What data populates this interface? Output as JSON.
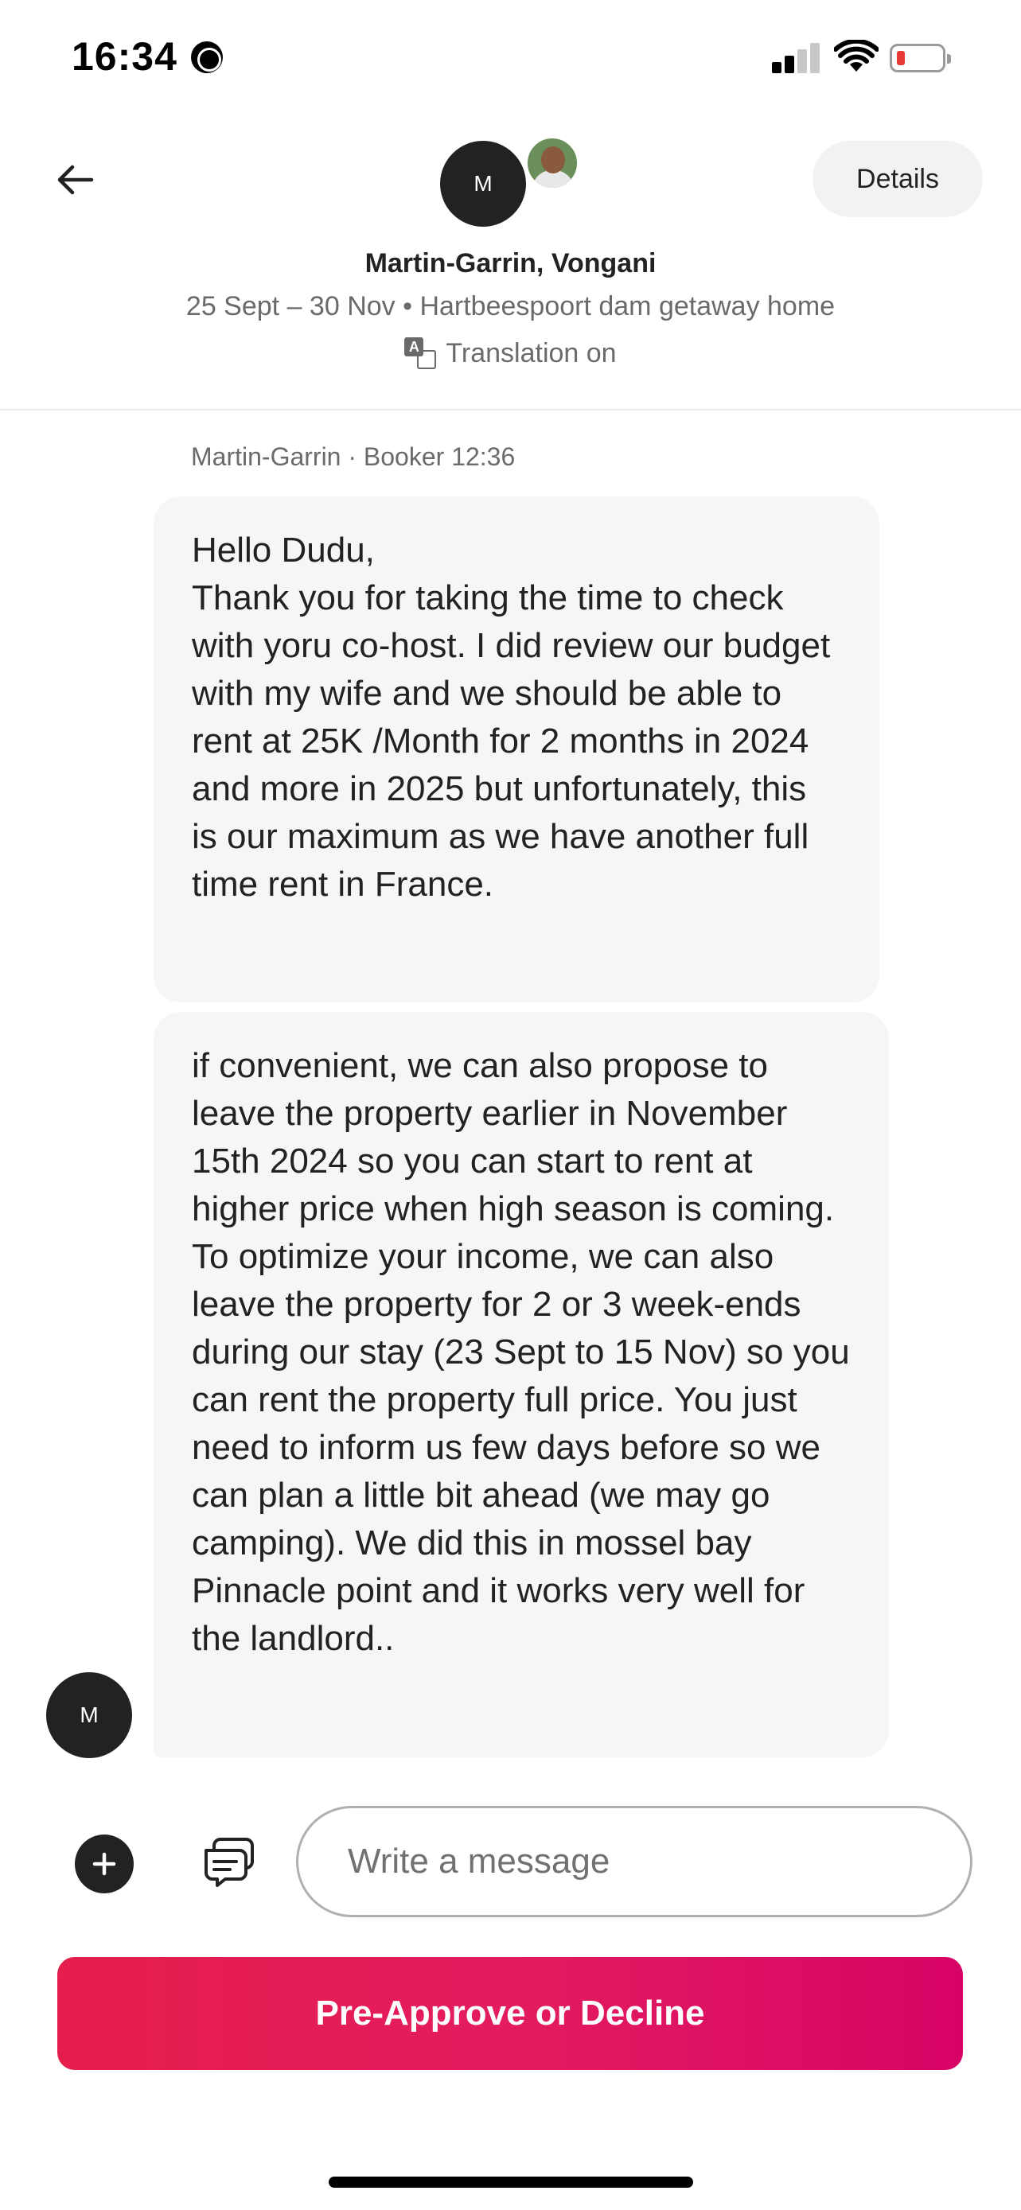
{
  "status_bar": {
    "time": "16:34"
  },
  "header": {
    "avatar_initial": "M",
    "details_label": "Details",
    "name": "Martin-Garrin, Vongani",
    "subtitle": "25 Sept – 30 Nov • Hartbeespoort dam getaway home",
    "translation_label": "Translation on",
    "translate_glyph": "A"
  },
  "thread": {
    "meta": "Martin-Garrin · Booker 12:36",
    "messages": [
      {
        "text": "Hello Dudu,\nThank you for taking the time to check with yoru co-host. I did review our budget with my wife and we should be able to rent at 25K /Month for 2 months in 2024 and more in 2025 but unfortunately, this is our maximum as we have another full time rent in France."
      },
      {
        "text": "if convenient, we can also propose to leave the property earlier in November 15th 2024 so you can start to rent at higher price when high season is coming. To optimize your income, we can also leave the property for 2 or 3 week-ends during our stay (23 Sept to 15 Nov) so you can rent the property full price. You just need to inform us few days before so we can plan a little bit ahead (we may go camping). We did this in mossel bay Pinnacle point and it works very well for the landlord.."
      }
    ],
    "sender_initial": "M"
  },
  "composer": {
    "placeholder": "Write a message"
  },
  "actions": {
    "primary_label": "Pre-Approve or Decline"
  },
  "colors": {
    "accent": "#E31C5F",
    "bubble": "#F6F6F6",
    "muted_text": "#6A6A6A"
  }
}
